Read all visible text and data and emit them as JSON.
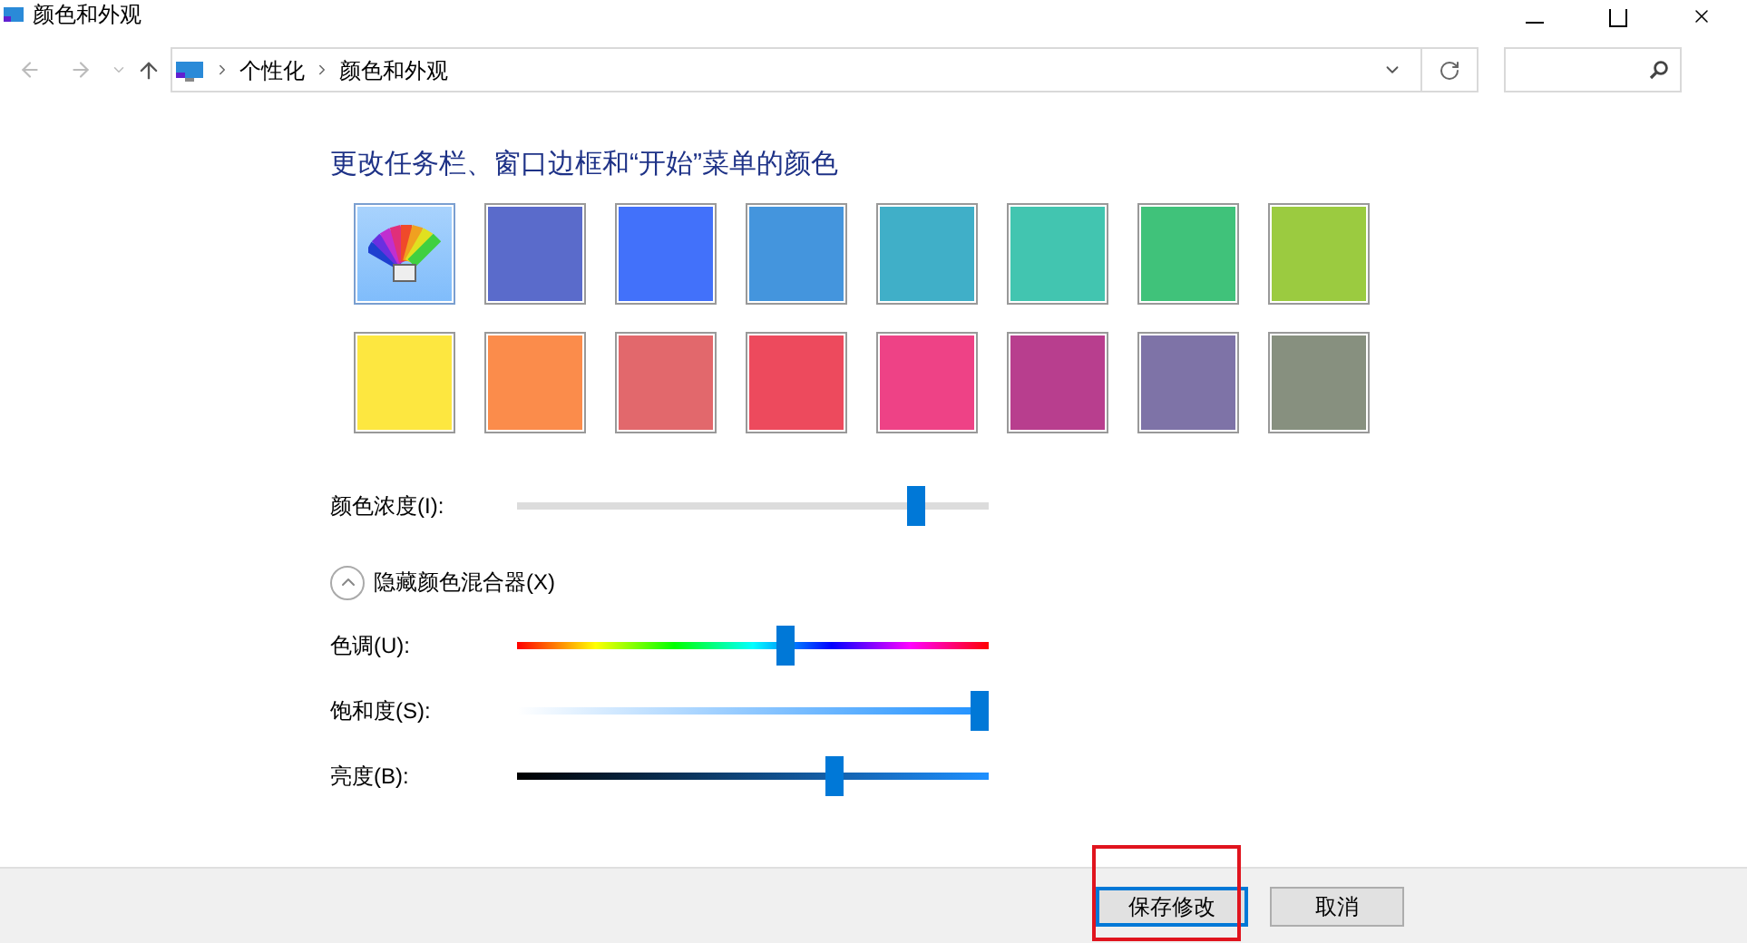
{
  "window": {
    "title": "颜色和外观"
  },
  "breadcrumb": [
    "个性化",
    "颜色和外观"
  ],
  "heading": "更改任务栏、窗口边框和“开始”菜单的颜色",
  "swatches": [
    {
      "kind": "custom",
      "selected": true
    },
    {
      "kind": "color",
      "color": "#5a6bcb",
      "selected": false
    },
    {
      "kind": "color",
      "color": "#4271fa",
      "selected": false
    },
    {
      "kind": "color",
      "color": "#4495dd",
      "selected": false
    },
    {
      "kind": "color",
      "color": "#40afc8",
      "selected": false
    },
    {
      "kind": "color",
      "color": "#42c5b0",
      "selected": false
    },
    {
      "kind": "color",
      "color": "#40c27a",
      "selected": false
    },
    {
      "kind": "color",
      "color": "#9bcb40",
      "selected": false
    },
    {
      "kind": "color",
      "color": "#fde740",
      "selected": false
    },
    {
      "kind": "color",
      "color": "#fb8c4b",
      "selected": false
    },
    {
      "kind": "color",
      "color": "#e2686c",
      "selected": false
    },
    {
      "kind": "color",
      "color": "#ed4a5d",
      "selected": false
    },
    {
      "kind": "color",
      "color": "#ee4286",
      "selected": false
    },
    {
      "kind": "color",
      "color": "#b83e8e",
      "selected": false
    },
    {
      "kind": "color",
      "color": "#7e73a7",
      "selected": false
    },
    {
      "kind": "color",
      "color": "#87907f",
      "selected": false
    }
  ],
  "intensity": {
    "label": "颜色浓度(I):",
    "level": 0.86
  },
  "mixer_toggle": {
    "label": "隐藏颜色混合器(X)",
    "expanded": true
  },
  "mixer": [
    {
      "kind": "hue",
      "label": "色调(U):",
      "level": 0.57
    },
    {
      "kind": "saturation",
      "label": "饱和度(S):",
      "level": 1.0
    },
    {
      "kind": "brightness",
      "label": "亮度(B):",
      "level": 0.68
    }
  ],
  "buttons": [
    {
      "label": "保存修改",
      "default": true,
      "highlighted": true
    },
    {
      "label": "取消",
      "default": false,
      "highlighted": false
    }
  ]
}
